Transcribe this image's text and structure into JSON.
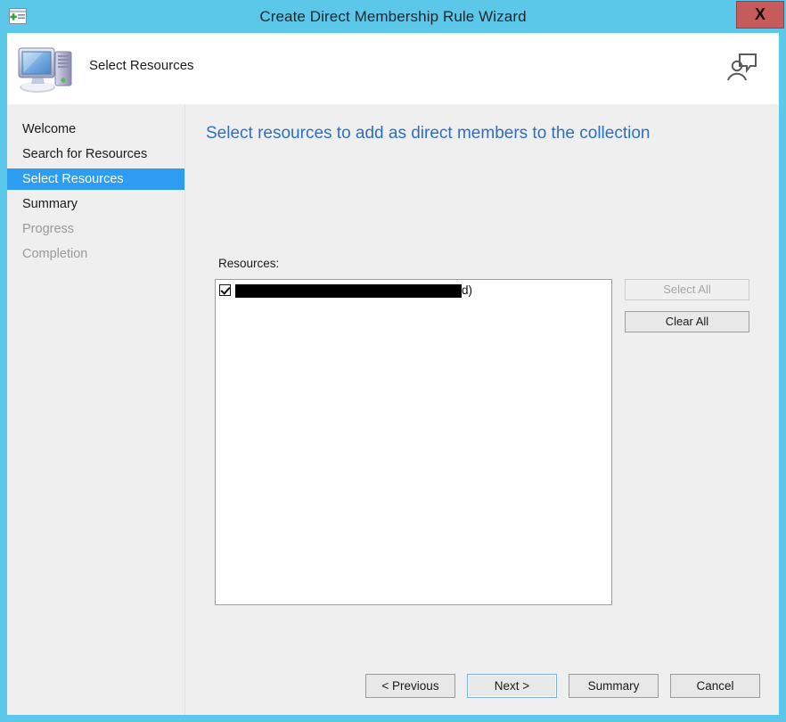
{
  "window": {
    "title": "Create Direct Membership Rule Wizard",
    "titlebar_icon": "new-window-icon",
    "close_label": "X",
    "frame_color": "#5bc8ea",
    "close_color": "#c75b5b"
  },
  "header": {
    "icon": "computer-icon",
    "title": "Select Resources",
    "right_icon": "user-account-icon"
  },
  "sidebar": {
    "items": [
      {
        "label": "Welcome",
        "state": "normal"
      },
      {
        "label": "Search for Resources",
        "state": "normal"
      },
      {
        "label": "Select Resources",
        "state": "selected"
      },
      {
        "label": "Summary",
        "state": "normal"
      },
      {
        "label": "Progress",
        "state": "disabled"
      },
      {
        "label": "Completion",
        "state": "disabled"
      }
    ],
    "selected_color": "#2e9cf0"
  },
  "content": {
    "heading": "Select resources to add as direct members to the collection",
    "heading_color": "#2d6fc4",
    "resources_label": "Resources:",
    "resources": [
      {
        "checked": true,
        "redacted": true,
        "tail_text": "d)"
      }
    ],
    "side_buttons": [
      {
        "label": "Select All",
        "enabled": false
      },
      {
        "label": "Clear All",
        "enabled": true
      }
    ]
  },
  "footer": {
    "buttons": [
      {
        "label": "< Previous",
        "focused": false
      },
      {
        "label": "Next >",
        "focused": true
      },
      {
        "label": "Summary",
        "focused": false
      },
      {
        "label": "Cancel",
        "focused": false
      }
    ]
  }
}
